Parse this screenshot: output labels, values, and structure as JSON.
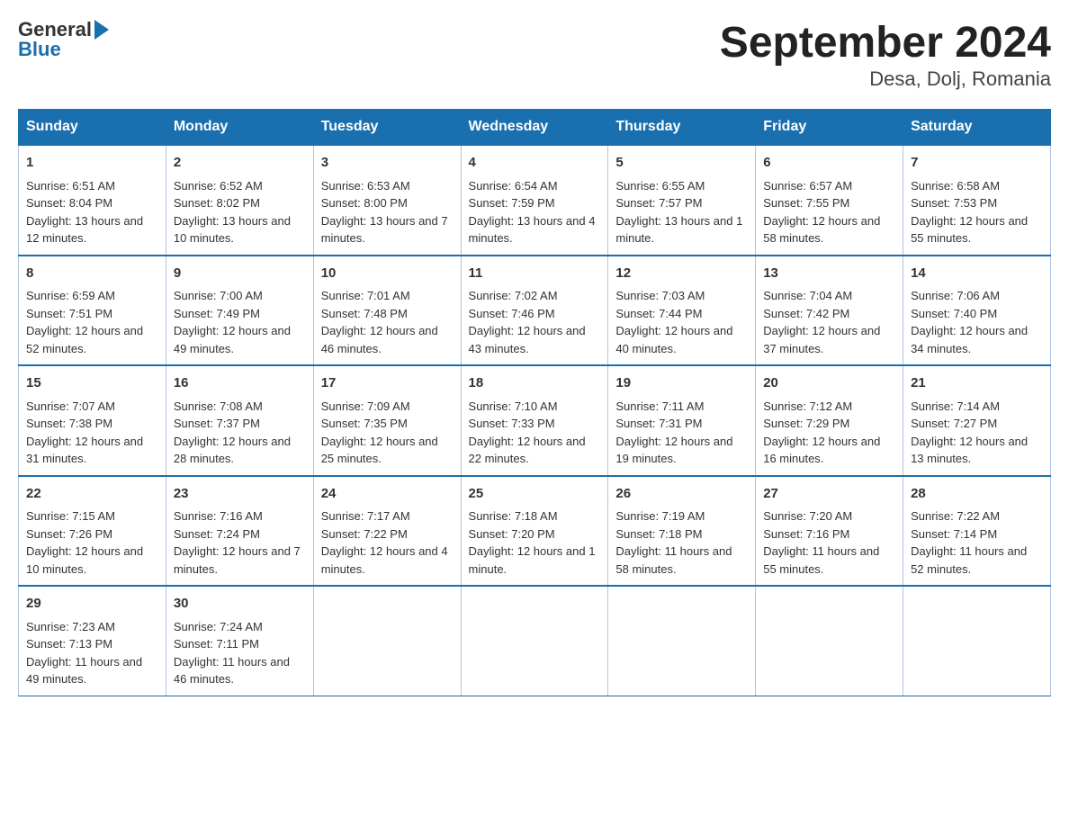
{
  "title": "September 2024",
  "subtitle": "Desa, Dolj, Romania",
  "logo": {
    "general": "General",
    "blue": "Blue"
  },
  "weekdays": [
    "Sunday",
    "Monday",
    "Tuesday",
    "Wednesday",
    "Thursday",
    "Friday",
    "Saturday"
  ],
  "weeks": [
    [
      {
        "day": "1",
        "sunrise": "Sunrise: 6:51 AM",
        "sunset": "Sunset: 8:04 PM",
        "daylight": "Daylight: 13 hours and 12 minutes."
      },
      {
        "day": "2",
        "sunrise": "Sunrise: 6:52 AM",
        "sunset": "Sunset: 8:02 PM",
        "daylight": "Daylight: 13 hours and 10 minutes."
      },
      {
        "day": "3",
        "sunrise": "Sunrise: 6:53 AM",
        "sunset": "Sunset: 8:00 PM",
        "daylight": "Daylight: 13 hours and 7 minutes."
      },
      {
        "day": "4",
        "sunrise": "Sunrise: 6:54 AM",
        "sunset": "Sunset: 7:59 PM",
        "daylight": "Daylight: 13 hours and 4 minutes."
      },
      {
        "day": "5",
        "sunrise": "Sunrise: 6:55 AM",
        "sunset": "Sunset: 7:57 PM",
        "daylight": "Daylight: 13 hours and 1 minute."
      },
      {
        "day": "6",
        "sunrise": "Sunrise: 6:57 AM",
        "sunset": "Sunset: 7:55 PM",
        "daylight": "Daylight: 12 hours and 58 minutes."
      },
      {
        "day": "7",
        "sunrise": "Sunrise: 6:58 AM",
        "sunset": "Sunset: 7:53 PM",
        "daylight": "Daylight: 12 hours and 55 minutes."
      }
    ],
    [
      {
        "day": "8",
        "sunrise": "Sunrise: 6:59 AM",
        "sunset": "Sunset: 7:51 PM",
        "daylight": "Daylight: 12 hours and 52 minutes."
      },
      {
        "day": "9",
        "sunrise": "Sunrise: 7:00 AM",
        "sunset": "Sunset: 7:49 PM",
        "daylight": "Daylight: 12 hours and 49 minutes."
      },
      {
        "day": "10",
        "sunrise": "Sunrise: 7:01 AM",
        "sunset": "Sunset: 7:48 PM",
        "daylight": "Daylight: 12 hours and 46 minutes."
      },
      {
        "day": "11",
        "sunrise": "Sunrise: 7:02 AM",
        "sunset": "Sunset: 7:46 PM",
        "daylight": "Daylight: 12 hours and 43 minutes."
      },
      {
        "day": "12",
        "sunrise": "Sunrise: 7:03 AM",
        "sunset": "Sunset: 7:44 PM",
        "daylight": "Daylight: 12 hours and 40 minutes."
      },
      {
        "day": "13",
        "sunrise": "Sunrise: 7:04 AM",
        "sunset": "Sunset: 7:42 PM",
        "daylight": "Daylight: 12 hours and 37 minutes."
      },
      {
        "day": "14",
        "sunrise": "Sunrise: 7:06 AM",
        "sunset": "Sunset: 7:40 PM",
        "daylight": "Daylight: 12 hours and 34 minutes."
      }
    ],
    [
      {
        "day": "15",
        "sunrise": "Sunrise: 7:07 AM",
        "sunset": "Sunset: 7:38 PM",
        "daylight": "Daylight: 12 hours and 31 minutes."
      },
      {
        "day": "16",
        "sunrise": "Sunrise: 7:08 AM",
        "sunset": "Sunset: 7:37 PM",
        "daylight": "Daylight: 12 hours and 28 minutes."
      },
      {
        "day": "17",
        "sunrise": "Sunrise: 7:09 AM",
        "sunset": "Sunset: 7:35 PM",
        "daylight": "Daylight: 12 hours and 25 minutes."
      },
      {
        "day": "18",
        "sunrise": "Sunrise: 7:10 AM",
        "sunset": "Sunset: 7:33 PM",
        "daylight": "Daylight: 12 hours and 22 minutes."
      },
      {
        "day": "19",
        "sunrise": "Sunrise: 7:11 AM",
        "sunset": "Sunset: 7:31 PM",
        "daylight": "Daylight: 12 hours and 19 minutes."
      },
      {
        "day": "20",
        "sunrise": "Sunrise: 7:12 AM",
        "sunset": "Sunset: 7:29 PM",
        "daylight": "Daylight: 12 hours and 16 minutes."
      },
      {
        "day": "21",
        "sunrise": "Sunrise: 7:14 AM",
        "sunset": "Sunset: 7:27 PM",
        "daylight": "Daylight: 12 hours and 13 minutes."
      }
    ],
    [
      {
        "day": "22",
        "sunrise": "Sunrise: 7:15 AM",
        "sunset": "Sunset: 7:26 PM",
        "daylight": "Daylight: 12 hours and 10 minutes."
      },
      {
        "day": "23",
        "sunrise": "Sunrise: 7:16 AM",
        "sunset": "Sunset: 7:24 PM",
        "daylight": "Daylight: 12 hours and 7 minutes."
      },
      {
        "day": "24",
        "sunrise": "Sunrise: 7:17 AM",
        "sunset": "Sunset: 7:22 PM",
        "daylight": "Daylight: 12 hours and 4 minutes."
      },
      {
        "day": "25",
        "sunrise": "Sunrise: 7:18 AM",
        "sunset": "Sunset: 7:20 PM",
        "daylight": "Daylight: 12 hours and 1 minute."
      },
      {
        "day": "26",
        "sunrise": "Sunrise: 7:19 AM",
        "sunset": "Sunset: 7:18 PM",
        "daylight": "Daylight: 11 hours and 58 minutes."
      },
      {
        "day": "27",
        "sunrise": "Sunrise: 7:20 AM",
        "sunset": "Sunset: 7:16 PM",
        "daylight": "Daylight: 11 hours and 55 minutes."
      },
      {
        "day": "28",
        "sunrise": "Sunrise: 7:22 AM",
        "sunset": "Sunset: 7:14 PM",
        "daylight": "Daylight: 11 hours and 52 minutes."
      }
    ],
    [
      {
        "day": "29",
        "sunrise": "Sunrise: 7:23 AM",
        "sunset": "Sunset: 7:13 PM",
        "daylight": "Daylight: 11 hours and 49 minutes."
      },
      {
        "day": "30",
        "sunrise": "Sunrise: 7:24 AM",
        "sunset": "Sunset: 7:11 PM",
        "daylight": "Daylight: 11 hours and 46 minutes."
      },
      null,
      null,
      null,
      null,
      null
    ]
  ]
}
